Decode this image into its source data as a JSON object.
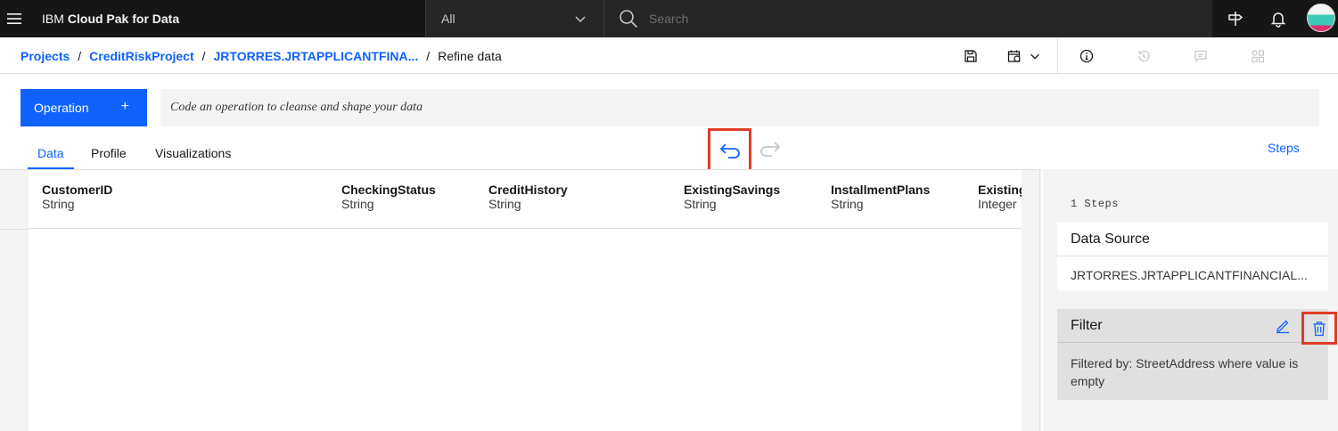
{
  "topnav": {
    "brand_prefix": "IBM",
    "brand_name": "Cloud Pak for Data",
    "scope_selected": "All",
    "search_placeholder": "Search"
  },
  "breadcrumb": {
    "items": [
      "Projects",
      "CreditRiskProject",
      "JRTORRES.JRTAPPLICANTFINA..."
    ],
    "current": "Refine data",
    "separator": "/"
  },
  "operation": {
    "button_label": "Operation",
    "button_icon": "+",
    "code_placeholder": "Code an operation to cleanse and shape your data"
  },
  "tabs": [
    {
      "label": "Data",
      "active": true
    },
    {
      "label": "Profile",
      "active": false
    },
    {
      "label": "Visualizations",
      "active": false
    }
  ],
  "steps_link": "Steps",
  "columns": [
    {
      "name": "CustomerID",
      "type": "String"
    },
    {
      "name": "CheckingStatus",
      "type": "String"
    },
    {
      "name": "CreditHistory",
      "type": "String"
    },
    {
      "name": "ExistingSavings",
      "type": "String"
    },
    {
      "name": "InstallmentPlans",
      "type": "String"
    },
    {
      "name": "Existing",
      "type": "Integer"
    }
  ],
  "steps_panel": {
    "count_label": "1 Steps",
    "source_title": "Data Source",
    "source_value": "JRTORRES.JRTAPPLICANTFINANCIAL...",
    "filter_title": "Filter",
    "filter_desc": "Filtered by: StreetAddress where value is empty"
  },
  "colors": {
    "nav_bg": "#161616",
    "accent": "#0f62fe",
    "highlight_box": "#e03c28",
    "panel_bg": "#f4f4f4"
  }
}
